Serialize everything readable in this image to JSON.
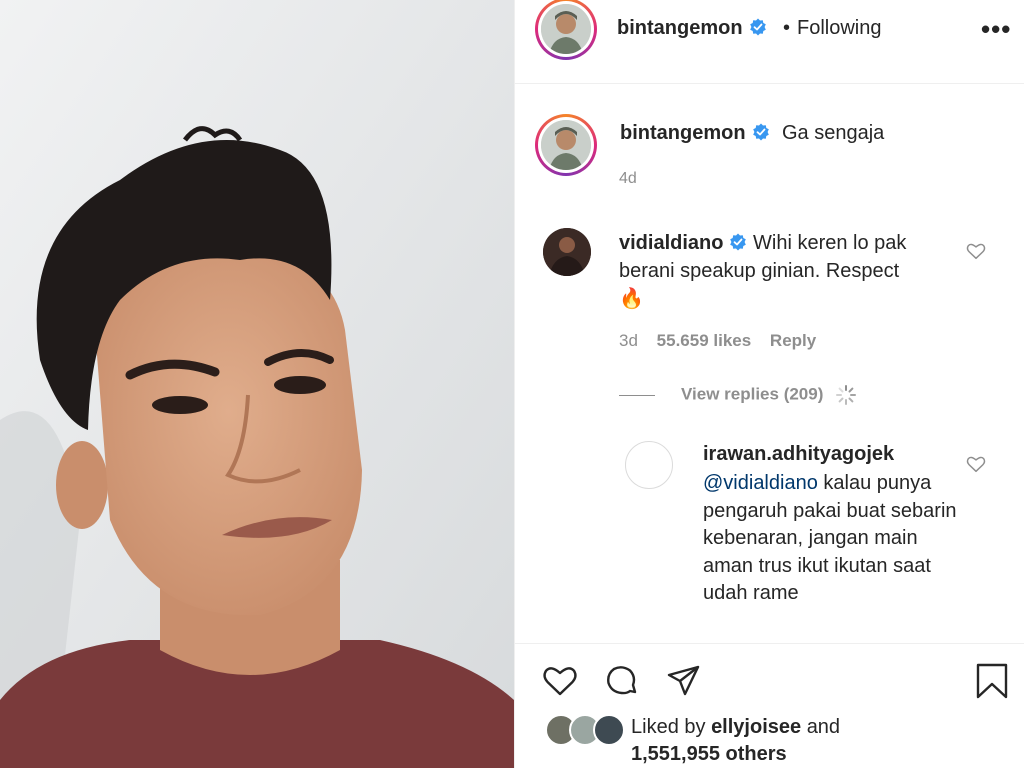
{
  "post": {
    "author": "bintangemon",
    "follow_status": "Following",
    "separator": "•",
    "more": "•••"
  },
  "caption": {
    "username": "bintangemon",
    "text": "Ga sengaja",
    "time": "4d"
  },
  "comment": {
    "username": "vidialdiano",
    "text": "Wihi keren lo pak berani speakup ginian. Respect",
    "emoji": "🔥",
    "time": "3d",
    "likes": "55.659 likes",
    "reply_label": "Reply",
    "view_replies": "View replies (209)"
  },
  "reply": {
    "username": "irawan.adhityagojek",
    "mention": "@vidialdiano",
    "text": "kalau punya pengaruh pakai buat sebarin kebenaran, jangan main aman trus ikut ikutan saat udah rame"
  },
  "likes_summary": {
    "prefix": "Liked by",
    "user": "ellyjoisee",
    "and": "and",
    "others": "1,551,955 others"
  },
  "colors": {
    "verified": "#3897f0",
    "muted": "#8e8e8e",
    "mention": "#00376b",
    "shirt": "#7a3a3b"
  },
  "icons": [
    "verified-badge-icon",
    "more-icon",
    "heart-icon",
    "comment-icon",
    "share-icon",
    "bookmark-icon",
    "spinner-icon"
  ]
}
